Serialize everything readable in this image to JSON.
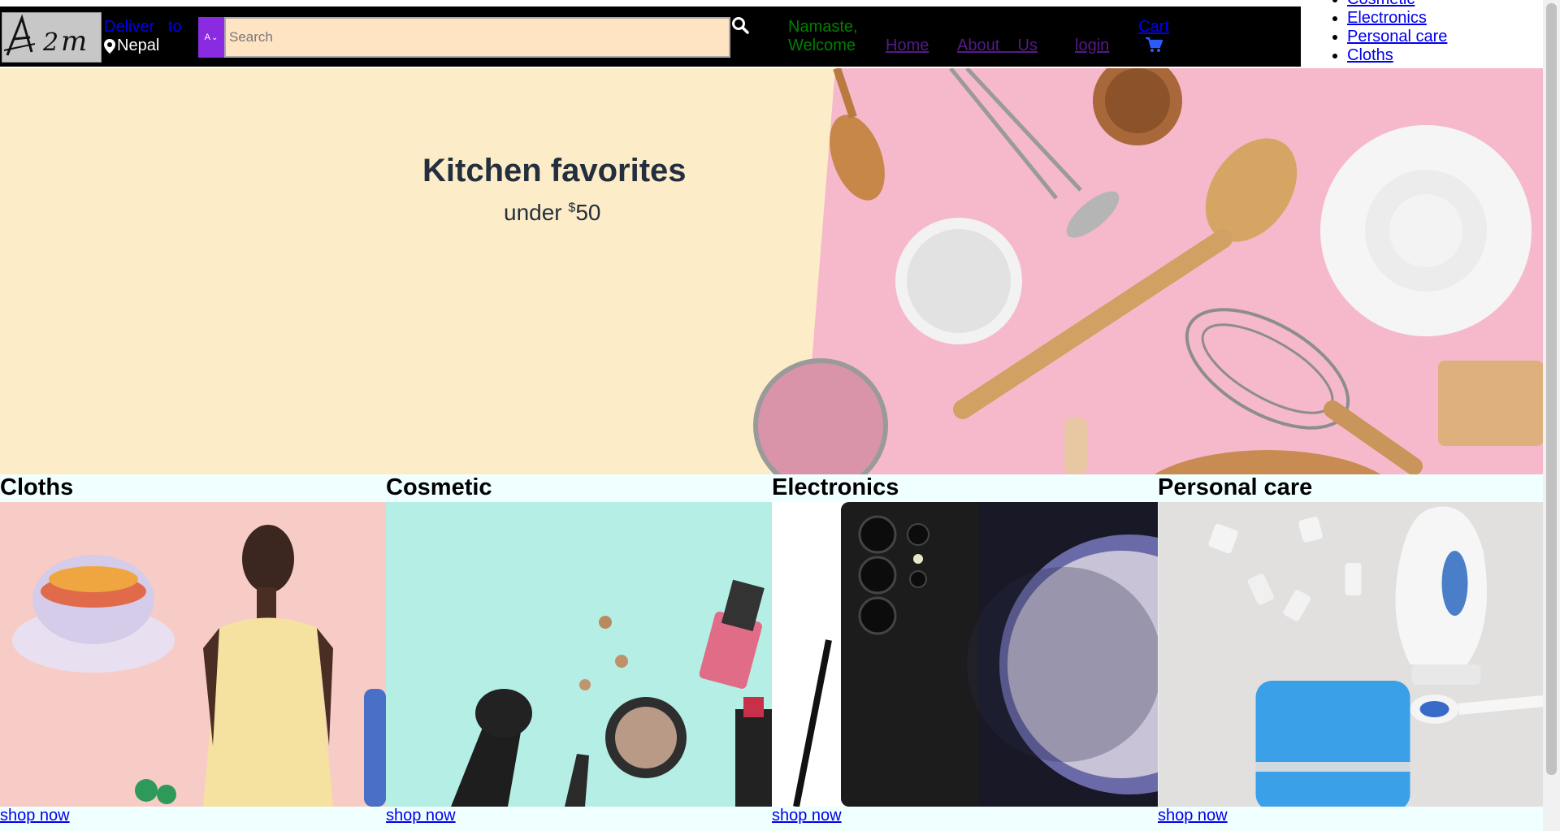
{
  "header": {
    "deliver_line1": "Deliver   to",
    "deliver_location": "Nepal",
    "select_value": "A",
    "search_placeholder": "Search",
    "greeting_line1": "Namaste,",
    "greeting_line2": "Welcome",
    "nav": {
      "home": "Home",
      "about": "About    Us",
      "login": "login"
    },
    "cart_label": "Cart"
  },
  "side_categories": [
    "Cosmetic",
    "Electronics",
    "Personal care",
    "Cloths"
  ],
  "hero": {
    "title": "Kitchen favorites",
    "subtitle_prefix": "under ",
    "currency": "$",
    "price": "50"
  },
  "cards": [
    {
      "title": "Cloths",
      "link": "shop now"
    },
    {
      "title": "Cosmetic",
      "link": "shop now"
    },
    {
      "title": "Electronics",
      "link": "shop now"
    },
    {
      "title": "Personal care",
      "link": "shop now"
    }
  ],
  "colors": {
    "navbar": "#000000",
    "search_bg": "#ffe4c4",
    "select_bg": "#8a2be2",
    "greeting": "#008000",
    "hero_bg": "#fdecc8",
    "hero_photo_bg": "#f7b8cc",
    "cards_bg": "#f0ffff"
  }
}
